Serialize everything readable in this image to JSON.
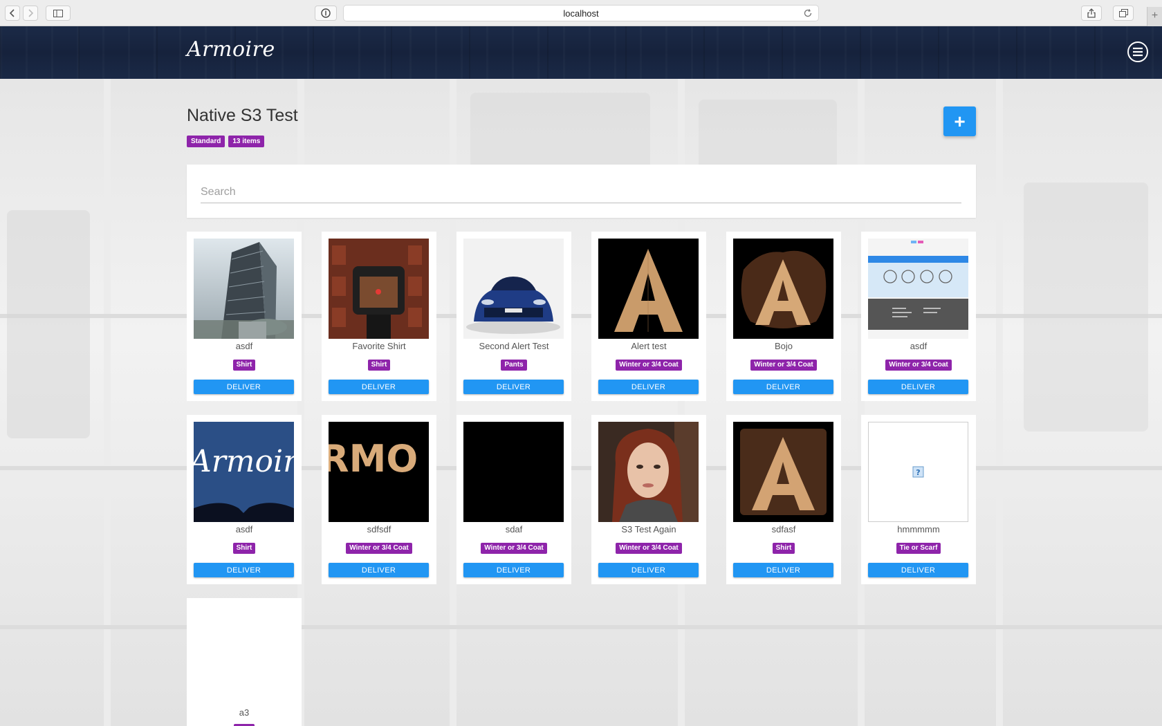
{
  "browser": {
    "url": "localhost",
    "icons": [
      "back-icon",
      "forward-icon",
      "sidebar-icon",
      "privacy-icon",
      "reload-icon",
      "share-icon",
      "tabs-icon",
      "new-tab-icon"
    ]
  },
  "header": {
    "logo": "Armoire",
    "menu_icon": "menu-icon"
  },
  "page": {
    "title": "Native S3 Test",
    "tags": [
      "Standard",
      "13 items"
    ],
    "add_button": "+",
    "search_placeholder": "Search",
    "deliver_label": "DELIVER"
  },
  "items": [
    {
      "name": "asdf",
      "category": "Shirt",
      "image": "skyscraper-photo"
    },
    {
      "name": "Favorite Shirt",
      "category": "Shirt",
      "image": "red-brick-building-scope"
    },
    {
      "name": "Second Alert Test",
      "category": "Pants",
      "image": "blue-car"
    },
    {
      "name": "Alert test",
      "category": "Winter or 3/4 Coat",
      "image": "letter-a-wood"
    },
    {
      "name": "Bojo",
      "category": "Winter or 3/4 Coat",
      "image": "letter-a-wood-dark"
    },
    {
      "name": "asdf",
      "category": "Winter or 3/4 Coat",
      "image": "website-screenshot"
    },
    {
      "name": "asdf",
      "category": "Shirt",
      "image": "armoire-logo-blue"
    },
    {
      "name": "sdfsdf",
      "category": "Winter or 3/4 Coat",
      "image": "armoire-wood-text"
    },
    {
      "name": "sdaf",
      "category": "Winter or 3/4 Coat",
      "image": "black"
    },
    {
      "name": "S3 Test Again",
      "category": "Winter or 3/4 Coat",
      "image": "portrait-photo"
    },
    {
      "name": "sdfasf",
      "category": "Shirt",
      "image": "letter-a-wood-square"
    },
    {
      "name": "hmmmmm",
      "category": "Tie or Scarf",
      "image": "broken-image"
    },
    {
      "name": "a3",
      "category": "",
      "image": "none"
    }
  ],
  "colors": {
    "accent": "#2196f3",
    "tag": "#8e24aa",
    "header": "#1a2946"
  }
}
